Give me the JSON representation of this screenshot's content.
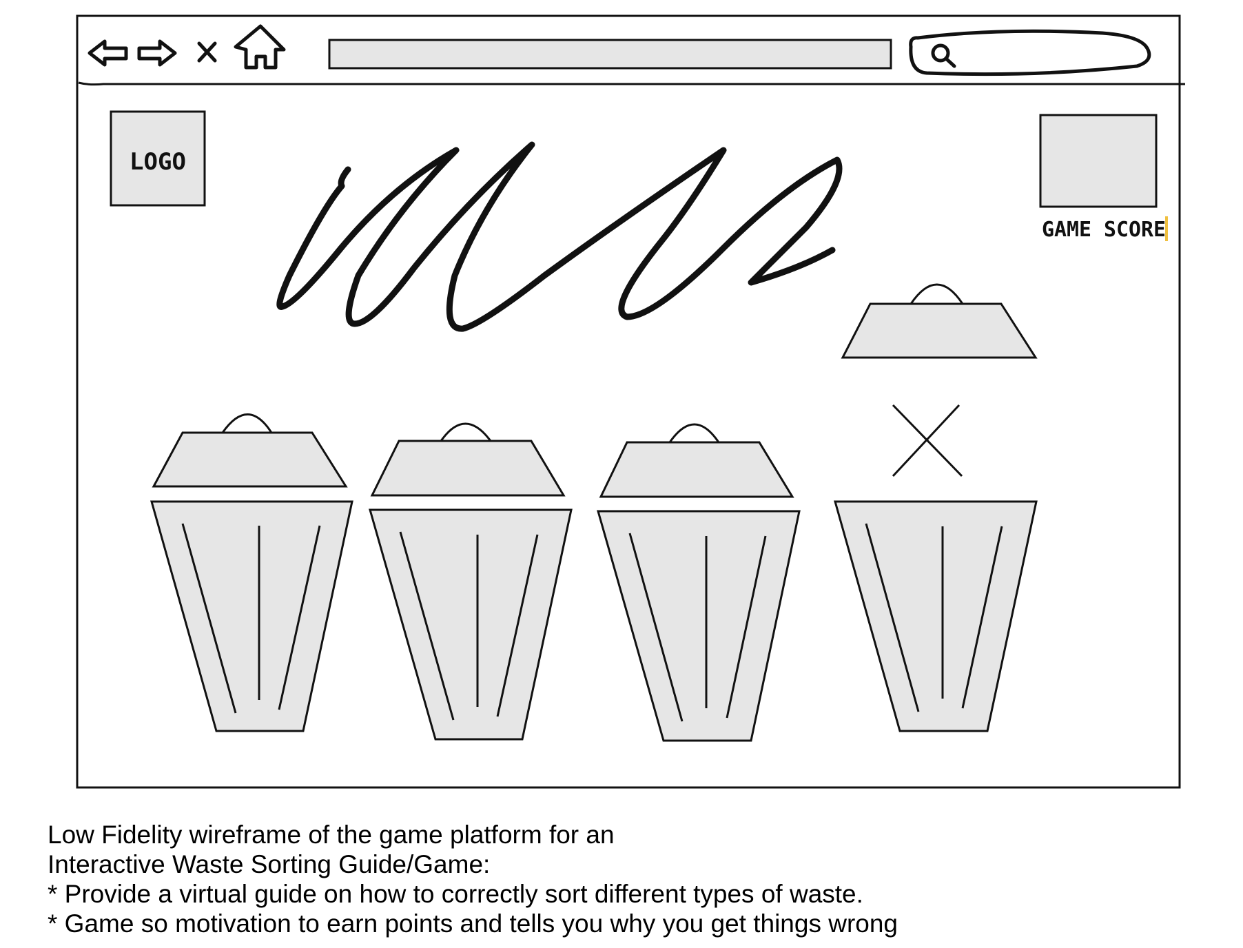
{
  "browser": {
    "nav_icons": [
      "back-arrow-icon",
      "forward-arrow-icon",
      "close-icon",
      "home-icon"
    ],
    "address_bar": {
      "value": ""
    },
    "search_icon": "search-icon"
  },
  "header": {
    "logo_label": "LOGO",
    "score_label": "GAME SCORE"
  },
  "game": {
    "bins": [
      {
        "id": "bin-1",
        "lid": "closed"
      },
      {
        "id": "bin-2",
        "lid": "closed"
      },
      {
        "id": "bin-3",
        "lid": "closed"
      },
      {
        "id": "bin-4",
        "lid": "open"
      }
    ],
    "wrong_marker": "x-mark-icon"
  },
  "caption": {
    "lines": [
      "Low Fidelity wireframe of the game platform for an",
      "Interactive Waste Sorting Guide/Game:",
      "* Provide a virtual guide on how to correctly sort different types of waste.",
      "* Game so motivation to earn points and tells you why you get things wrong"
    ]
  },
  "colors": {
    "fill": "#e6e6e6",
    "stroke": "#111111",
    "cursor": "#f0c040"
  }
}
